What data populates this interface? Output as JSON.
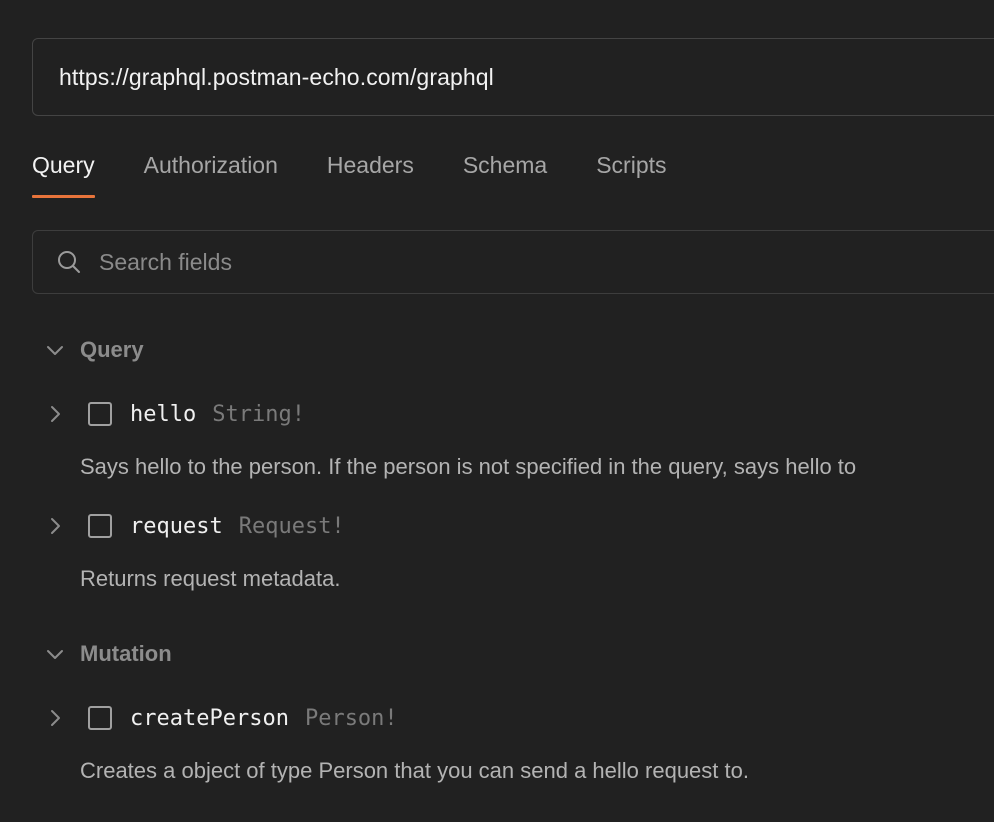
{
  "url_bar": {
    "value": "https://graphql.postman-echo.com/graphql"
  },
  "tabs": [
    {
      "label": "Query",
      "active": true
    },
    {
      "label": "Authorization",
      "active": false
    },
    {
      "label": "Headers",
      "active": false
    },
    {
      "label": "Schema",
      "active": false
    },
    {
      "label": "Scripts",
      "active": false
    }
  ],
  "search": {
    "placeholder": "Search fields",
    "icon": "search-icon"
  },
  "sections": [
    {
      "title": "Query",
      "fields": [
        {
          "name": "hello",
          "type": "String!",
          "description": "Says hello to the person. If the person is not specified in the query, says hello to"
        },
        {
          "name": "request",
          "type": "Request!",
          "description": "Returns request metadata."
        }
      ]
    },
    {
      "title": "Mutation",
      "fields": [
        {
          "name": "createPerson",
          "type": "Person!",
          "description": "Creates a object of type Person that you can send a hello request to."
        }
      ]
    }
  ],
  "colors": {
    "background": "#212121",
    "accent": "#e8743b",
    "muted_text": "#a6a6a6",
    "type_text": "#7a7a7a"
  }
}
